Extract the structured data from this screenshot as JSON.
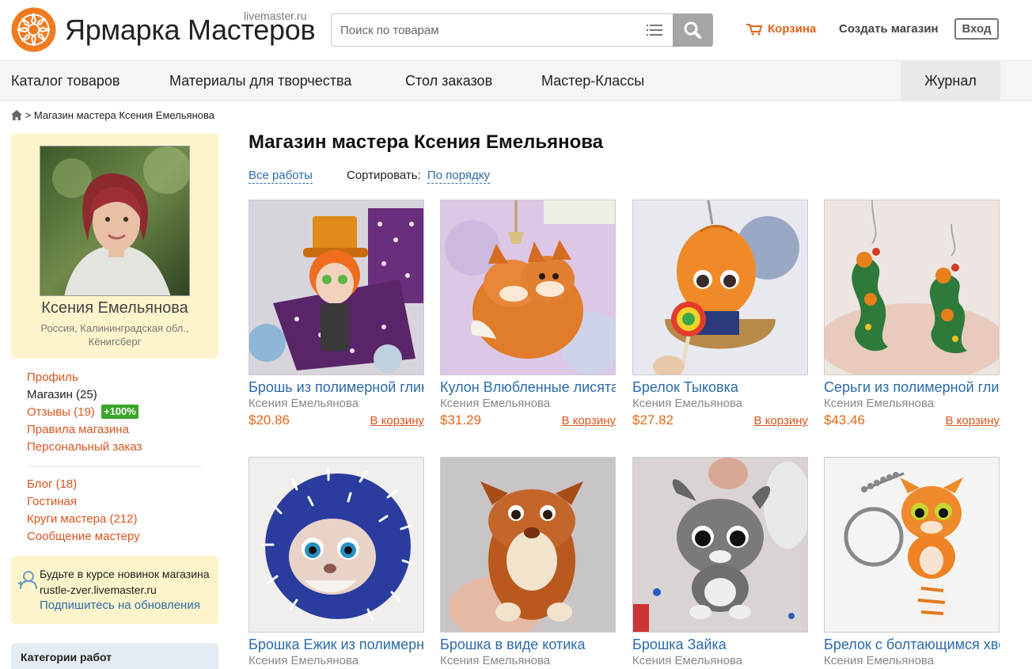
{
  "colors": {
    "accent": "#e0661c",
    "link": "#2c6aa7",
    "sidebar_bg": "#fdf4cc",
    "rating_green": "#3aa629"
  },
  "header": {
    "logo_text": "Ярмарка Мастеров",
    "logo_subtext": "livemaster.ru",
    "search_placeholder": "Поиск по товарам",
    "cart_label": "Корзина",
    "create_shop_label": "Создать магазин",
    "login_label": "Вход",
    "icons": [
      "sun-logo-icon",
      "list-icon",
      "search-icon",
      "cart-icon"
    ]
  },
  "nav": {
    "items": [
      "Каталог товаров",
      "Материалы для творчества",
      "Стол заказов",
      "Мастер-Классы"
    ],
    "journal": "Журнал"
  },
  "breadcrumb": {
    "separator": ">",
    "current": "Магазин мастера Ксения Емельянова"
  },
  "profile": {
    "name": "Ксения Емельянова",
    "location_line1": "Россия, Калининградская обл.,",
    "location_line2": "Кёнигсберг"
  },
  "sidebar": {
    "profile": "Профиль",
    "shop": "Магазин",
    "shop_count": "(25)",
    "reviews": "Отзывы",
    "reviews_count": "(19)",
    "rating": "+100%",
    "rules": "Правила магазина",
    "personal_order": "Персональный заказ",
    "blog": "Блог",
    "blog_count": "(18)",
    "lounge": "Гостиная",
    "circles": "Круги мастера",
    "circles_count": "(212)",
    "message": "Сообщение мастеру"
  },
  "subscribe": {
    "line1": "Будьте в курсе новинок магазина",
    "line2": "rustle-zver.livemaster.ru",
    "link": "Подпишитесь на обновления"
  },
  "categories": {
    "title": "Категории работ"
  },
  "main": {
    "title": "Магазин мастера Ксения Емельянова",
    "filter_all": "Все работы",
    "sort_label": "Сортировать:",
    "sort_value": "По порядку"
  },
  "products": [
    {
      "title": "Брошь из полимерной глины",
      "seller": "Ксения Емельянова",
      "price": "$20.86",
      "cart": "В корзину"
    },
    {
      "title": "Кулон Влюбленные лисята",
      "seller": "Ксения Емельянова",
      "price": "$31.29",
      "cart": "В корзину"
    },
    {
      "title": "Брелок Тыковка",
      "seller": "Ксения Емельянова",
      "price": "$27.82",
      "cart": "В корзину"
    },
    {
      "title": "Серьги из полимерной глины",
      "seller": "Ксения Емельянова",
      "price": "$43.46",
      "cart": "В корзину"
    },
    {
      "title": "Брошка Ежик из полимерной глины",
      "seller": "Ксения Емельянова"
    },
    {
      "title": "Брошка в виде котика",
      "seller": "Ксения Емельянова"
    },
    {
      "title": "Брошка Зайка",
      "seller": "Ксения Емельянова"
    },
    {
      "title": "Брелок с болтающимся хвостом",
      "seller": "Ксения Емельянова"
    }
  ]
}
